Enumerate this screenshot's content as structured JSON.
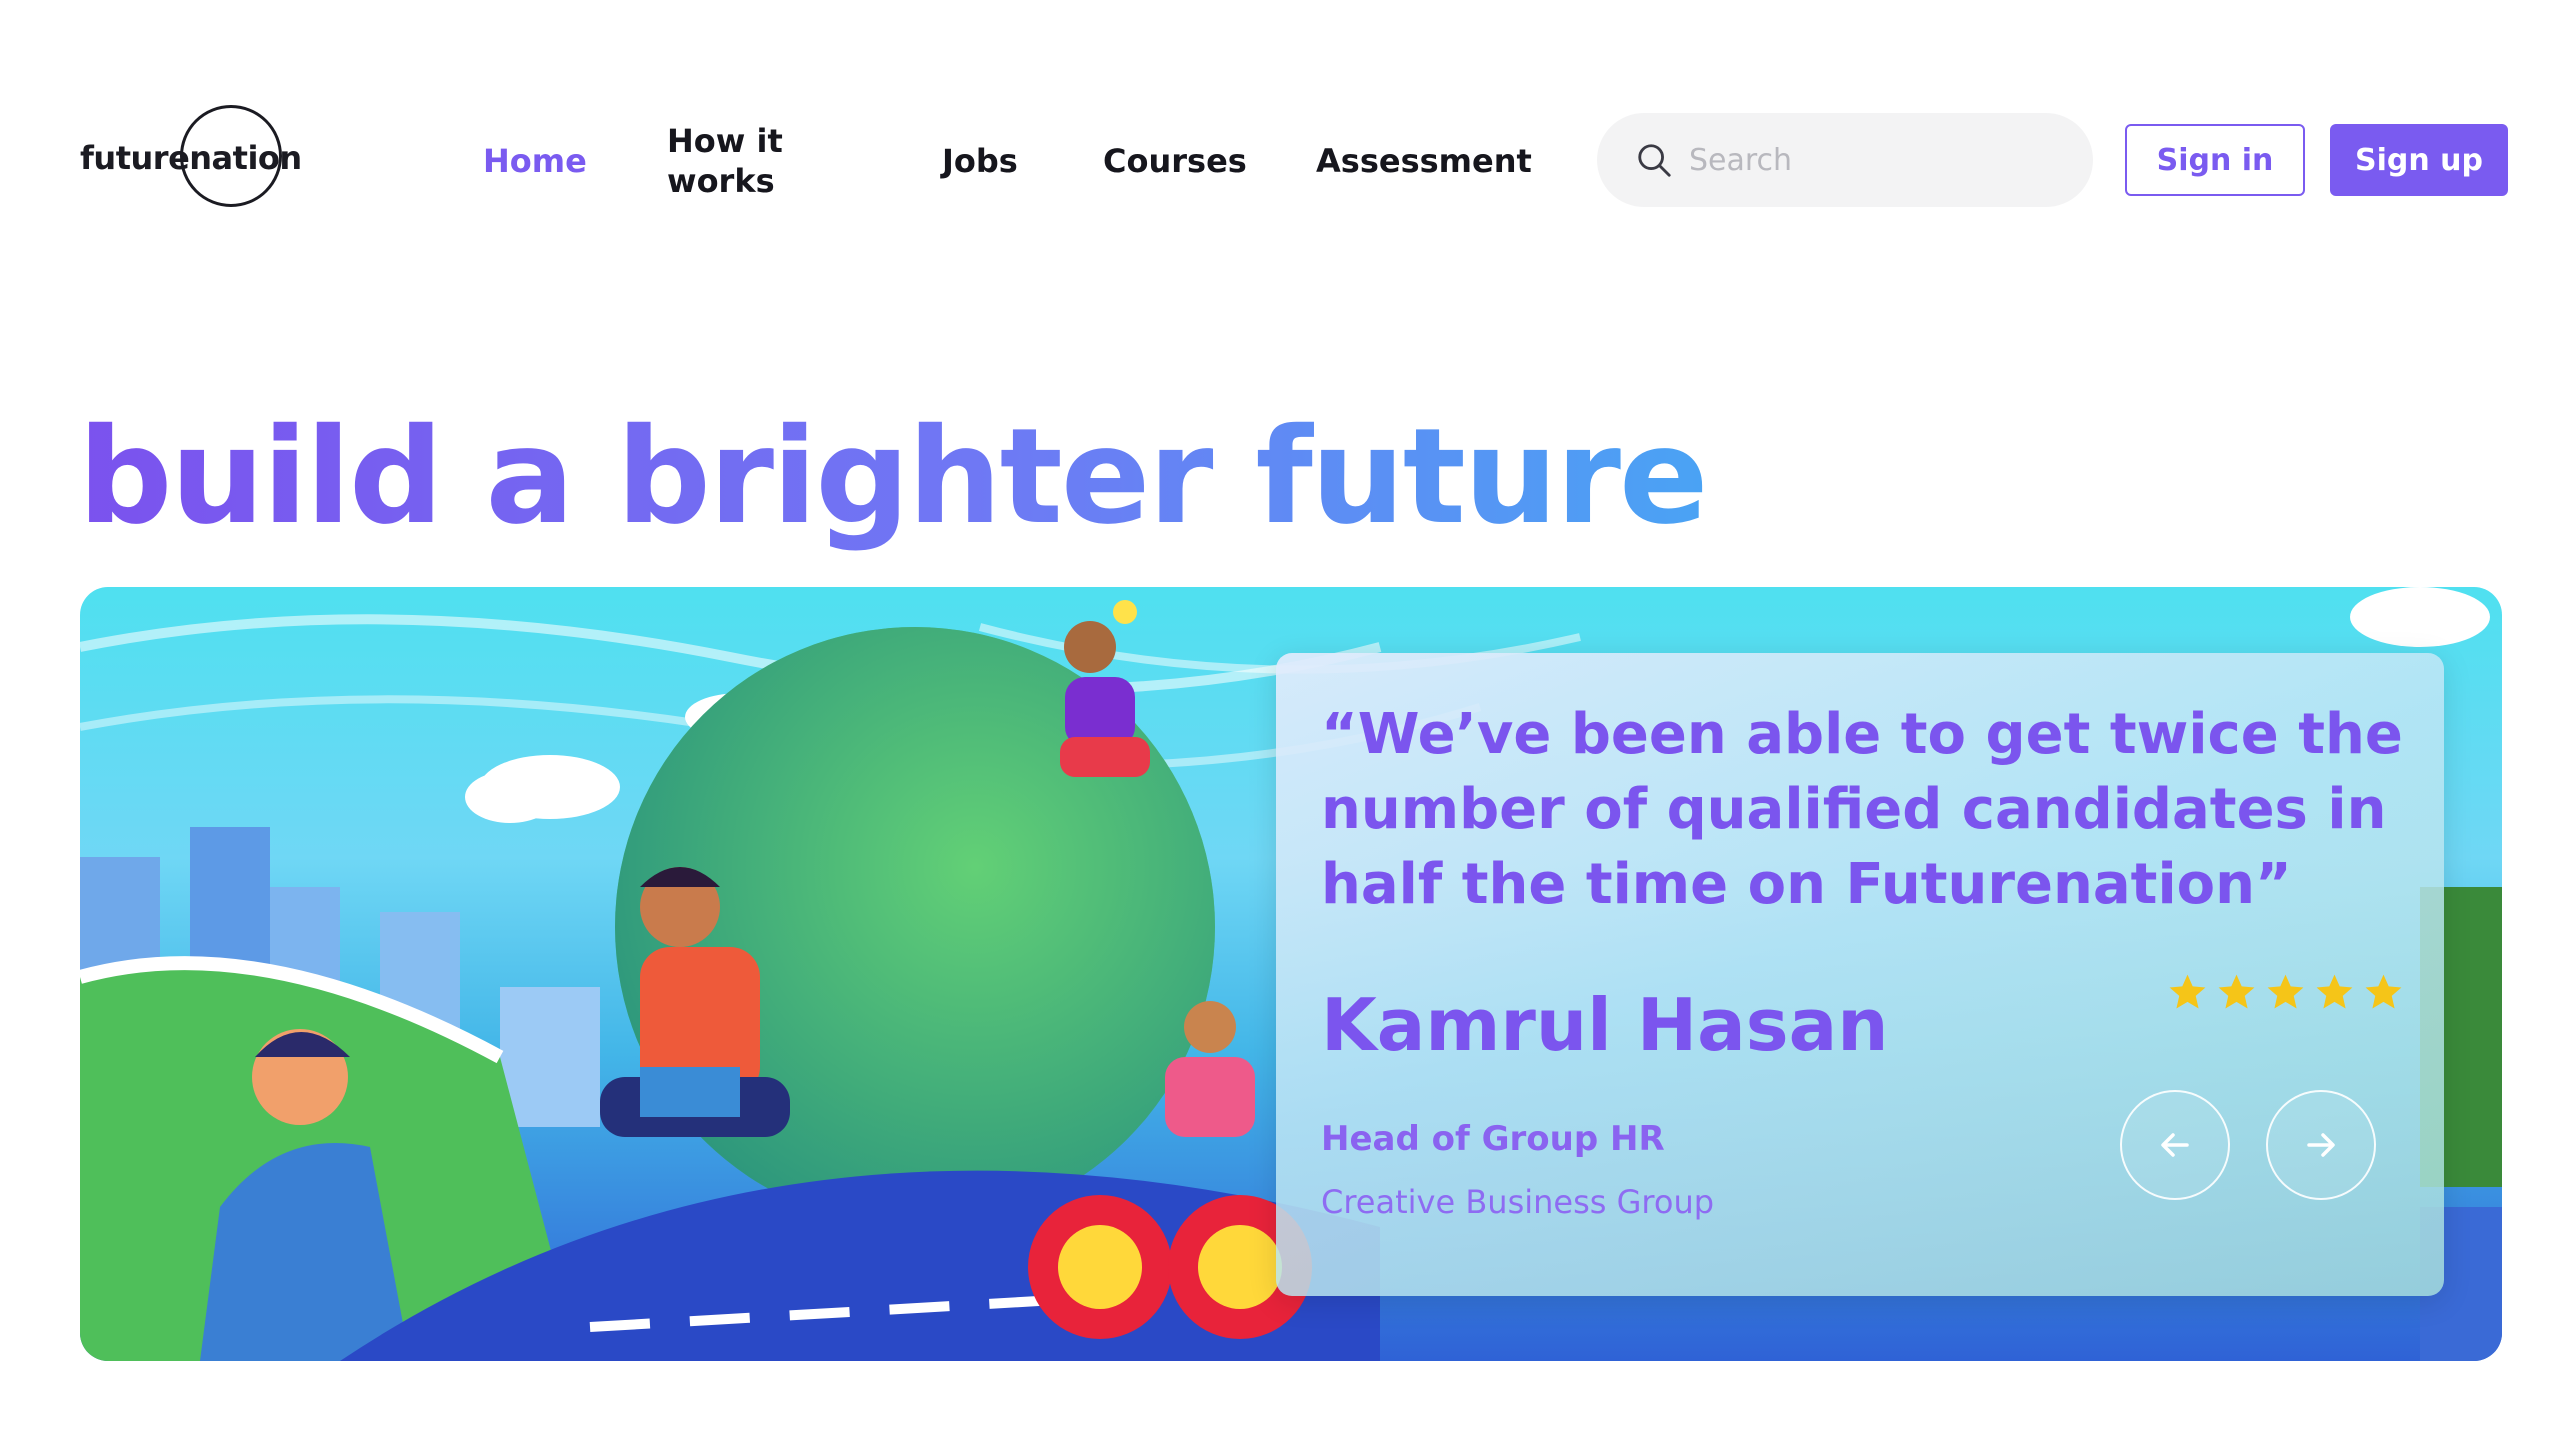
{
  "header": {
    "logo_text": "futurenation",
    "nav": [
      {
        "label": "Home",
        "active": true
      },
      {
        "label": "How it works",
        "active": false
      },
      {
        "label": "Jobs",
        "active": false
      },
      {
        "label": "Courses",
        "active": false
      },
      {
        "label": "Assessment",
        "active": false
      }
    ],
    "search": {
      "placeholder": "Search",
      "value": ""
    },
    "sign_in_label": "Sign in",
    "sign_up_label": "Sign up"
  },
  "hero": {
    "title": "build a brighter future"
  },
  "testimonial": {
    "quote": "“We’ve been able to get twice the number of qualified candidates in half the time on Futurenation”",
    "author": "Kamrul Hasan",
    "role": "Head of Group HR",
    "company": "Creative Business Group",
    "rating": 5,
    "prev_icon": "arrow-left-icon",
    "next_icon": "arrow-right-icon"
  },
  "colors": {
    "accent": "#7a5bf0",
    "gradient_start": "#7b52ee",
    "gradient_end": "#4aa3f4",
    "star": "#f5c518"
  }
}
